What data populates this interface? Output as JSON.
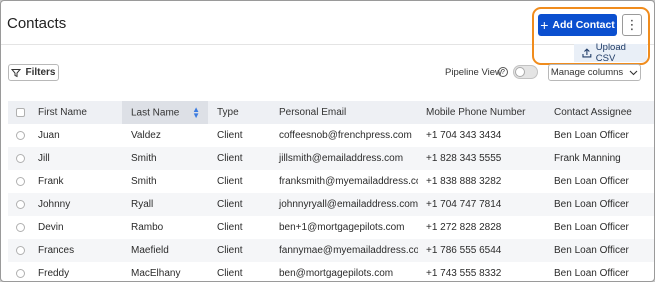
{
  "header": {
    "title": "Contacts",
    "add_label": "Add Contact",
    "more_label": "⋮",
    "upload_label": "Upload CSV"
  },
  "toolbar": {
    "filters_label": "Filters",
    "pipeline_label": "Pipeline View",
    "pipeline_enabled": false,
    "manage_label": "Manage columns"
  },
  "table": {
    "columns": [
      "First Name",
      "Last Name",
      "Type",
      "Personal Email",
      "Mobile Phone Number",
      "Contact Assignee"
    ],
    "sorted_column": "Last Name",
    "rows": [
      {
        "first": "Juan",
        "last": "Valdez",
        "type": "Client",
        "email": "coffeesnob@frenchpress.com",
        "mobile": "+1 704 343 3434",
        "assignee": "Ben Loan Officer"
      },
      {
        "first": "Jill",
        "last": "Smith",
        "type": "Client",
        "email": "jillsmith@emailaddress.com",
        "mobile": "+1 828 343 5555",
        "assignee": "Frank Manning"
      },
      {
        "first": "Frank",
        "last": "Smith",
        "type": "Client",
        "email": "franksmith@myemailaddress.com",
        "mobile": "+1 838 888 3282",
        "assignee": "Ben Loan Officer"
      },
      {
        "first": "Johnny",
        "last": "Ryall",
        "type": "Client",
        "email": "johnnyryall@emailaddress.com",
        "mobile": "+1 704 747 7814",
        "assignee": "Ben Loan Officer"
      },
      {
        "first": "Devin",
        "last": "Rambo",
        "type": "Client",
        "email": "ben+1@mortgagepilots.com",
        "mobile": "+1 272 828 2828",
        "assignee": "Ben Loan Officer"
      },
      {
        "first": "Frances",
        "last": "Maefield",
        "type": "Client",
        "email": "fannymae@myemailaddress.com",
        "mobile": "+1 786 555 6544",
        "assignee": "Ben Loan Officer"
      },
      {
        "first": "Freddy",
        "last": "MacElhany",
        "type": "Client",
        "email": "ben@mortgagepilots.com",
        "mobile": "+1 743 555 8332",
        "assignee": "Ben Loan Officer"
      }
    ]
  },
  "colors": {
    "accent": "#0b4fcf",
    "highlight": "#f08c1d"
  }
}
